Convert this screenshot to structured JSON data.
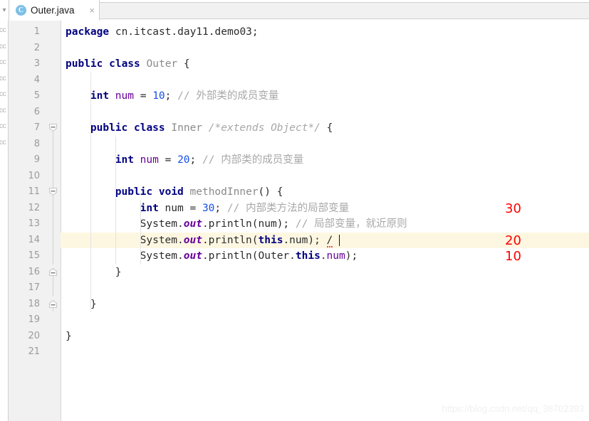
{
  "window": {
    "tab": {
      "icon": "java-class-icon",
      "icon_letter": "C",
      "title": "Outer.java",
      "close_glyph": "×"
    },
    "toolbar_stub": "▾"
  },
  "editor": {
    "left_stub_fragments": [
      "cc",
      "cc",
      "cc",
      "cc",
      "cc",
      "cc",
      "cc",
      "cc"
    ],
    "line_numbers": [
      "1",
      "2",
      "3",
      "4",
      "5",
      "6",
      "7",
      "8",
      "9",
      "10",
      "11",
      "12",
      "13",
      "14",
      "15",
      "16",
      "17",
      "18",
      "19",
      "20",
      "21"
    ],
    "highlighted_line": 14,
    "caret_line": 14,
    "lines": [
      {
        "n": 1,
        "indent": 0,
        "tokens": [
          {
            "t": "package ",
            "c": "kw"
          },
          {
            "t": "cn.itcast.day11.demo03;",
            "c": "plain"
          }
        ]
      },
      {
        "n": 2,
        "indent": 0,
        "tokens": []
      },
      {
        "n": 3,
        "indent": 0,
        "tokens": [
          {
            "t": "public class ",
            "c": "kw"
          },
          {
            "t": "Outer",
            "c": "type"
          },
          {
            "t": " {",
            "c": "plain"
          }
        ]
      },
      {
        "n": 4,
        "indent": 0,
        "tokens": []
      },
      {
        "n": 5,
        "indent": 1,
        "tokens": [
          {
            "t": "int ",
            "c": "kw"
          },
          {
            "t": "num",
            "c": "field"
          },
          {
            "t": " = ",
            "c": "plain"
          },
          {
            "t": "10",
            "c": "num"
          },
          {
            "t": "; ",
            "c": "plain"
          },
          {
            "t": "// 外部类的成员变量",
            "c": "cmt"
          }
        ]
      },
      {
        "n": 6,
        "indent": 0,
        "tokens": []
      },
      {
        "n": 7,
        "indent": 1,
        "tokens": [
          {
            "t": "public class ",
            "c": "kw"
          },
          {
            "t": "Inner ",
            "c": "type"
          },
          {
            "t": "/*extends Object*/",
            "c": "cmt-i"
          },
          {
            "t": " {",
            "c": "plain"
          }
        ]
      },
      {
        "n": 8,
        "indent": 0,
        "tokens": []
      },
      {
        "n": 9,
        "indent": 2,
        "tokens": [
          {
            "t": "int ",
            "c": "kw"
          },
          {
            "t": "num",
            "c": "field"
          },
          {
            "t": " = ",
            "c": "plain"
          },
          {
            "t": "20",
            "c": "num"
          },
          {
            "t": "; ",
            "c": "plain"
          },
          {
            "t": "// 内部类的成员变量",
            "c": "cmt"
          }
        ]
      },
      {
        "n": 10,
        "indent": 0,
        "tokens": []
      },
      {
        "n": 11,
        "indent": 2,
        "tokens": [
          {
            "t": "public void ",
            "c": "kw"
          },
          {
            "t": "methodInner",
            "c": "type"
          },
          {
            "t": "() {",
            "c": "plain"
          }
        ]
      },
      {
        "n": 12,
        "indent": 3,
        "tokens": [
          {
            "t": "int ",
            "c": "kw"
          },
          {
            "t": "num",
            "c": "plain"
          },
          {
            "t": " = ",
            "c": "plain"
          },
          {
            "t": "30",
            "c": "num"
          },
          {
            "t": "; ",
            "c": "plain"
          },
          {
            "t": "// 内部类方法的局部变量",
            "c": "cmt"
          }
        ]
      },
      {
        "n": 13,
        "indent": 3,
        "tokens": [
          {
            "t": "System.",
            "c": "plain"
          },
          {
            "t": "out",
            "c": "stat"
          },
          {
            "t": ".println(num); ",
            "c": "plain"
          },
          {
            "t": "// 局部变量，就近原则",
            "c": "cmt"
          }
        ]
      },
      {
        "n": 14,
        "indent": 3,
        "tokens": [
          {
            "t": "System.",
            "c": "plain"
          },
          {
            "t": "out",
            "c": "stat"
          },
          {
            "t": ".println(",
            "c": "plain"
          },
          {
            "t": "this",
            "c": "kw"
          },
          {
            "t": ".num); ",
            "c": "plain"
          },
          {
            "t": "/",
            "c": "err"
          },
          {
            "t": " ",
            "c": "plain"
          }
        ]
      },
      {
        "n": 15,
        "indent": 3,
        "tokens": [
          {
            "t": "System.",
            "c": "plain"
          },
          {
            "t": "out",
            "c": "stat"
          },
          {
            "t": ".println(Outer.",
            "c": "plain"
          },
          {
            "t": "this",
            "c": "kw"
          },
          {
            "t": ".",
            "c": "plain"
          },
          {
            "t": "num",
            "c": "field"
          },
          {
            "t": ");",
            "c": "plain"
          }
        ]
      },
      {
        "n": 16,
        "indent": 2,
        "tokens": [
          {
            "t": "}",
            "c": "plain"
          }
        ]
      },
      {
        "n": 17,
        "indent": 0,
        "tokens": []
      },
      {
        "n": 18,
        "indent": 1,
        "tokens": [
          {
            "t": "}",
            "c": "plain"
          }
        ]
      },
      {
        "n": 19,
        "indent": 0,
        "tokens": []
      },
      {
        "n": 20,
        "indent": 0,
        "tokens": [
          {
            "t": "}",
            "c": "plain"
          }
        ]
      },
      {
        "n": 21,
        "indent": 0,
        "tokens": []
      }
    ],
    "fold_markers": [
      {
        "line": 7,
        "kind": "collapse"
      },
      {
        "line": 11,
        "kind": "collapse"
      },
      {
        "line": 16,
        "kind": "end"
      },
      {
        "line": 18,
        "kind": "end"
      }
    ]
  },
  "annotations": [
    {
      "text": "30",
      "line": 12
    },
    {
      "text": "20",
      "line": 14
    },
    {
      "text": "10",
      "line": 15
    }
  ],
  "watermark": "https://blog.csdn.net/qq_38702393",
  "colors": {
    "keyword": "#000080",
    "field": "#660099",
    "number": "#1750eb",
    "comment": "#a8a8a8",
    "annotation_red": "#ff0000",
    "caret_line_bg": "#fdf7e2",
    "gutter_bg": "#f0f1f0",
    "tab_icon_bg": "#7cc0e8"
  }
}
